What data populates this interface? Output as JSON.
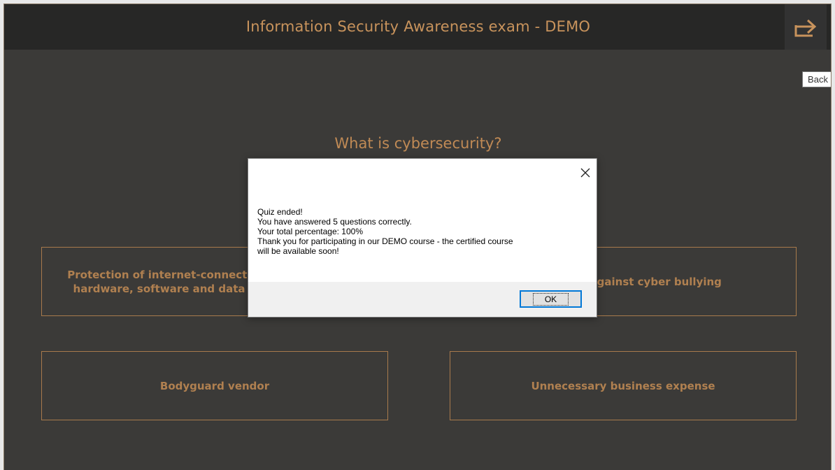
{
  "header": {
    "title": "Information Security Awareness exam - DEMO",
    "exit_icon": "exit-arrow-icon",
    "tooltip": "Back"
  },
  "question": {
    "text": "What is cybersecurity?"
  },
  "answers": [
    {
      "label_line1": "Protection of internet-connected systems such as",
      "label_line2": "hardware, software and data from cyberthreats"
    },
    {
      "label": "Protection against cyber bullying"
    },
    {
      "label": "Bodyguard vendor"
    },
    {
      "label": "Unnecessary business expense"
    }
  ],
  "dialog": {
    "close_icon": "close-icon",
    "lines": [
      "Quiz ended!",
      "You have answered 5 questions correctly.",
      "Your total percentage: 100%",
      "Thank you for participating in our DEMO course - the certified course",
      "will be available soon!"
    ],
    "ok_label": "OK"
  },
  "colors": {
    "background": "#3b3a38",
    "header": "#272726",
    "accent": "#c8935c"
  }
}
